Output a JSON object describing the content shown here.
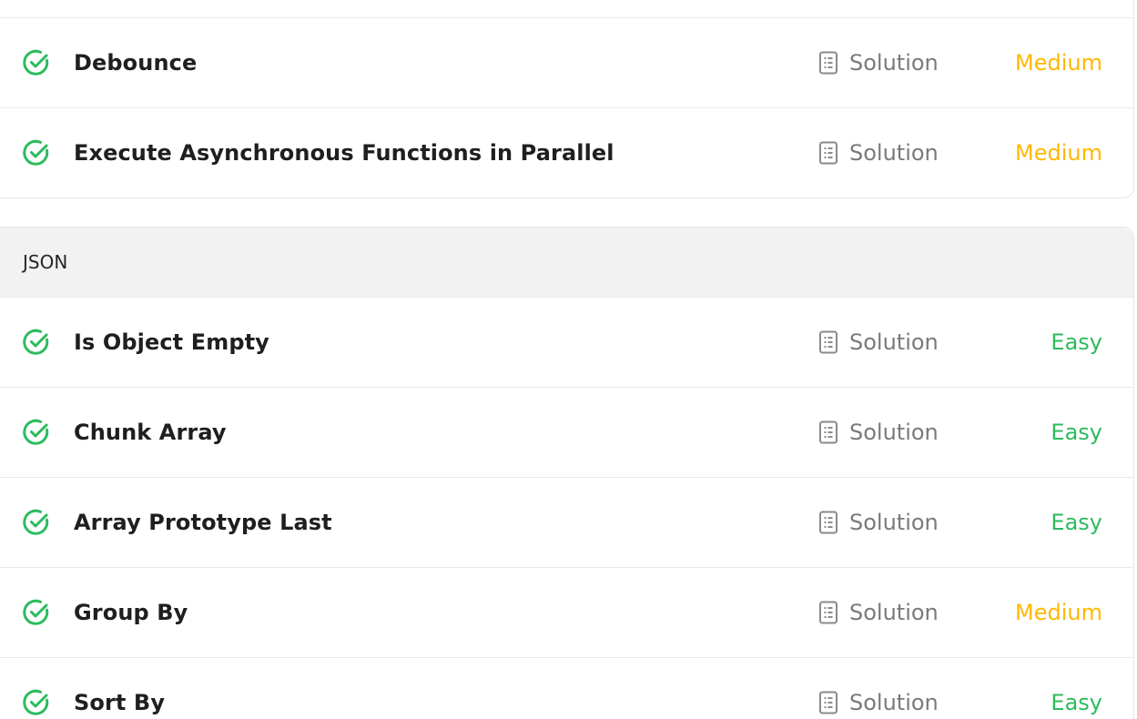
{
  "colors": {
    "easy": "#2cbb5d",
    "medium": "#ffb800",
    "check": "#2cbb5d",
    "solution_text": "#7a7a7a"
  },
  "icons": {
    "status": "check-circle-icon",
    "solution": "document-icon"
  },
  "top_group": {
    "problems": [
      {
        "title": "Debounce",
        "solution_label": "Solution",
        "difficulty": "Medium"
      },
      {
        "title": "Execute Asynchronous Functions in Parallel",
        "solution_label": "Solution",
        "difficulty": "Medium"
      }
    ]
  },
  "json_group": {
    "header": "JSON",
    "problems": [
      {
        "title": "Is Object Empty",
        "solution_label": "Solution",
        "difficulty": "Easy"
      },
      {
        "title": "Chunk Array",
        "solution_label": "Solution",
        "difficulty": "Easy"
      },
      {
        "title": "Array Prototype Last",
        "solution_label": "Solution",
        "difficulty": "Easy"
      },
      {
        "title": "Group By",
        "solution_label": "Solution",
        "difficulty": "Medium"
      },
      {
        "title": "Sort By",
        "solution_label": "Solution",
        "difficulty": "Easy"
      }
    ]
  }
}
